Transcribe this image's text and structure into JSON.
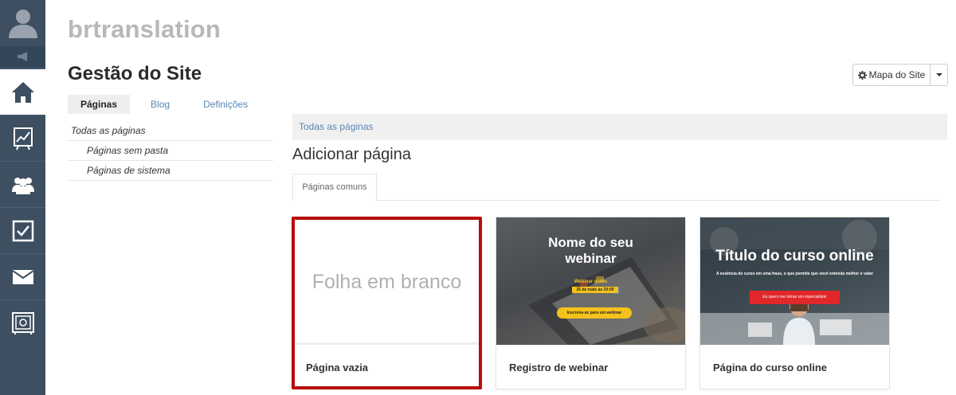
{
  "account": {
    "name": "brtranslation"
  },
  "page": {
    "title": "Gestão do Site"
  },
  "sitemap_button": {
    "label": "Mapa do Site"
  },
  "tabs": [
    {
      "label": "Páginas",
      "active": true
    },
    {
      "label": "Blog",
      "active": false
    },
    {
      "label": "Definições",
      "active": false
    }
  ],
  "folders": [
    {
      "label": "Todas as páginas",
      "level": 0
    },
    {
      "label": "Páginas sem pasta",
      "level": 1
    },
    {
      "label": "Páginas de sistema",
      "level": 1
    }
  ],
  "breadcrumb": "Todas as páginas",
  "section_title": "Adicionar página",
  "sub_tabs": [
    {
      "label": "Páginas comuns",
      "active": true
    }
  ],
  "templates": [
    {
      "name": "Página vazia",
      "thumb_text": "Folha em branco",
      "selected": true
    },
    {
      "name": "Registro de webinar",
      "thumb_title": "Nome do seu webinar",
      "thumb_small": "Webinar grátis",
      "thumb_date": "25 de maio às 20:00",
      "thumb_button": "Inscreva-se para um webinar"
    },
    {
      "name": "Página do curso online",
      "thumb_title": "Título do curso online",
      "thumb_sub": "A essência do curso em uma frase, o que permite que você entenda melhor o valor",
      "thumb_button": "Eu quero me tornar um especialista!"
    }
  ],
  "sidebar": {
    "items": [
      {
        "icon": "home-icon",
        "active": true
      },
      {
        "icon": "chart-icon",
        "active": false
      },
      {
        "icon": "users-icon",
        "active": false
      },
      {
        "icon": "checkbox-icon",
        "active": false
      },
      {
        "icon": "mail-icon",
        "active": false
      },
      {
        "icon": "safe-icon",
        "active": false
      }
    ]
  },
  "colors": {
    "sidebar": "#3d4f60",
    "link": "#5a86b3",
    "selected_border": "#b80c0c",
    "accent_yellow": "#f4c21b",
    "accent_red": "#e0282a"
  }
}
